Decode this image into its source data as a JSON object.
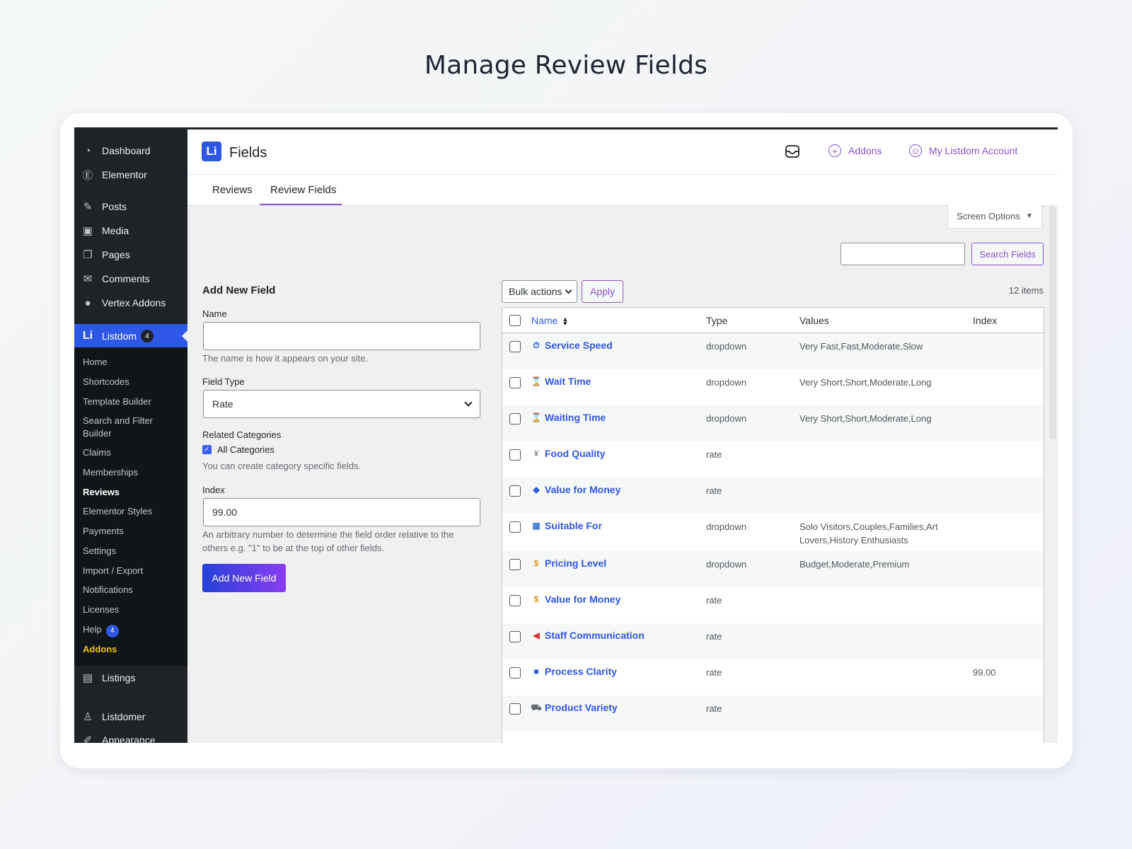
{
  "page_title": "Manage Review Fields",
  "sidebar": {
    "items": [
      {
        "label": "Dashboard",
        "icon": "dashboard-icon",
        "glyph": "◔"
      },
      {
        "label": "Elementor",
        "icon": "elementor-icon",
        "glyph": "Ⓔ"
      },
      {
        "label": "Posts",
        "icon": "pin-icon",
        "glyph": "✎"
      },
      {
        "label": "Media",
        "icon": "media-icon",
        "glyph": "▣"
      },
      {
        "label": "Pages",
        "icon": "pages-icon",
        "glyph": "❐"
      },
      {
        "label": "Comments",
        "icon": "comment-icon",
        "glyph": "✉"
      },
      {
        "label": "Vertex Addons",
        "icon": "vertex-icon",
        "glyph": "●"
      }
    ],
    "active": {
      "label": "Listdom",
      "badge": "4",
      "icon": "listdom-icon",
      "glyph": "Li"
    },
    "submenu": [
      "Home",
      "Shortcodes",
      "Template Builder",
      "Search and Filter Builder",
      "Claims",
      "Memberships",
      "Reviews",
      "Elementor Styles",
      "Payments",
      "Settings",
      "Import / Export",
      "Notifications",
      "Licenses",
      "Help",
      "Addons"
    ],
    "help_badge": "4",
    "bottom_items": [
      {
        "label": "Listings",
        "icon": "listings-icon",
        "glyph": "▤"
      },
      {
        "label": "Listdomer",
        "icon": "listdomer-icon",
        "glyph": "♙"
      },
      {
        "label": "Appearance",
        "icon": "appearance-icon",
        "glyph": "✐"
      }
    ]
  },
  "header": {
    "logo": "Li",
    "title": "Fields",
    "addons_label": "Addons",
    "account_label": "My Listdom Account"
  },
  "tabs": [
    "Reviews",
    "Review Fields"
  ],
  "screen_options": "Screen Options",
  "search": {
    "button": "Search Fields",
    "value": ""
  },
  "form": {
    "heading": "Add New Field",
    "name_label": "Name",
    "name_value": "",
    "name_help": "The name is how it appears on your site.",
    "type_label": "Field Type",
    "type_value": "Rate",
    "categories_label": "Related Categories",
    "all_categories": "All Categories",
    "categories_help": "You can create category specific fields.",
    "index_label": "Index",
    "index_value": "99.00",
    "index_help": "An arbitrary number to determine the field order relative to the others e.g. \"1\" to be at the top of other fields.",
    "submit": "Add New Field"
  },
  "table": {
    "bulk_actions": "Bulk actions",
    "apply": "Apply",
    "count": "12 items",
    "columns": [
      "Name",
      "Type",
      "Values",
      "Index"
    ],
    "rows": [
      {
        "name": "Service Speed",
        "icon": "stopwatch-icon",
        "glyph": "⏱",
        "color": "#2f57e6",
        "type": "dropdown",
        "values": "Very Fast,Fast,Moderate,Slow",
        "index": ""
      },
      {
        "name": "Wait Time",
        "icon": "hourglass-icon",
        "glyph": "⌛",
        "color": "#d99a1e",
        "type": "dropdown",
        "values": "Very Short,Short,Moderate,Long",
        "index": ""
      },
      {
        "name": "Waiting Time",
        "icon": "hourglass-icon",
        "glyph": "⌛",
        "color": "#d99a1e",
        "type": "dropdown",
        "values": "Very Short,Short,Moderate,Long",
        "index": ""
      },
      {
        "name": "Food Quality",
        "icon": "fork-knife-icon",
        "glyph": "¥",
        "color": "#8c8f94",
        "type": "rate",
        "values": "",
        "index": ""
      },
      {
        "name": "Value for Money",
        "icon": "tag-icon",
        "glyph": "◆",
        "color": "#2f57e6",
        "type": "rate",
        "values": "",
        "index": ""
      },
      {
        "name": "Suitable For",
        "icon": "people-icon",
        "glyph": "▦",
        "color": "#3a7bd5",
        "type": "dropdown",
        "values": "Solo Visitors,Couples,Families,Art Lovers,History Enthusiasts",
        "index": ""
      },
      {
        "name": "Pricing Level",
        "icon": "money-bag-icon",
        "glyph": "$",
        "color": "#d99a1e",
        "type": "dropdown",
        "values": "Budget,Moderate,Premium",
        "index": ""
      },
      {
        "name": "Value for Money",
        "icon": "money-bag-icon",
        "glyph": "$",
        "color": "#d99a1e",
        "type": "rate",
        "values": "",
        "index": ""
      },
      {
        "name": "Staff Communication",
        "icon": "megaphone-icon",
        "glyph": "◀",
        "color": "#d63638",
        "type": "rate",
        "values": "",
        "index": ""
      },
      {
        "name": "Process Clarity",
        "icon": "folder-icon",
        "glyph": "■",
        "color": "#2f57e6",
        "type": "rate",
        "values": "",
        "index": "99.00"
      },
      {
        "name": "Product Variety",
        "icon": "cart-icon",
        "glyph": "⛟",
        "color": "#646970",
        "type": "rate",
        "values": "",
        "index": ""
      }
    ]
  }
}
